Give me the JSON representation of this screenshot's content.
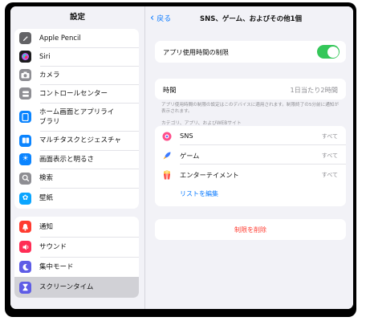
{
  "sidebar": {
    "title": "設定",
    "group1": [
      {
        "label": "Apple Pencil",
        "icon": "pencil-icon",
        "color": "#636366"
      },
      {
        "label": "Siri",
        "icon": "siri-icon",
        "color": "#1c1c1e"
      },
      {
        "label": "カメラ",
        "icon": "camera-icon",
        "color": "#8e8e93"
      },
      {
        "label": "コントロールセンター",
        "icon": "control-center-icon",
        "color": "#8e8e93"
      },
      {
        "label": "ホーム画面とアプリライブラリ",
        "icon": "home-screen-icon",
        "color": "#0a84ff"
      },
      {
        "label": "マルチタスクとジェスチャ",
        "icon": "multitask-icon",
        "color": "#0a84ff"
      },
      {
        "label": "画面表示と明るさ",
        "icon": "brightness-icon",
        "color": "#0a84ff"
      },
      {
        "label": "検索",
        "icon": "search-icon",
        "color": "#8e8e93"
      },
      {
        "label": "壁紙",
        "icon": "wallpaper-icon",
        "color": "#0aa5ff"
      }
    ],
    "group2": [
      {
        "label": "通知",
        "icon": "bell-icon",
        "color": "#ff3b30"
      },
      {
        "label": "サウンド",
        "icon": "speaker-icon",
        "color": "#ff2d55"
      },
      {
        "label": "集中モード",
        "icon": "moon-icon",
        "color": "#5e5ce6"
      },
      {
        "label": "スクリーンタイム",
        "icon": "hourglass-icon",
        "color": "#5e5ce6",
        "selected": true
      }
    ]
  },
  "nav": {
    "back": "戻る",
    "title": "SNS、ゲーム、およびその他1個"
  },
  "limit_toggle": {
    "label": "アプリ使用時間の制限",
    "on": true
  },
  "time": {
    "label": "時間",
    "value": "1日当たり2時間"
  },
  "footnote": "アプリ使用時間の制限の設定はこのデバイスに適用されます。制限終了の5分前に通知が表示されます。",
  "section_header": "カテゴリ、アプリ、およびWEBサイト",
  "categories": [
    {
      "label": "SNS",
      "value": "すべて",
      "icon": "sns-icon"
    },
    {
      "label": "ゲーム",
      "value": "すべて",
      "icon": "rocket-icon"
    },
    {
      "label": "エンターテイメント",
      "value": "すべて",
      "icon": "popcorn-icon"
    }
  ],
  "edit_list": "リストを編集",
  "delete_limit": "制限を削除",
  "colors": {
    "accent": "#0a7aff",
    "toggle_on": "#34c759",
    "destructive": "#ff3b30"
  }
}
